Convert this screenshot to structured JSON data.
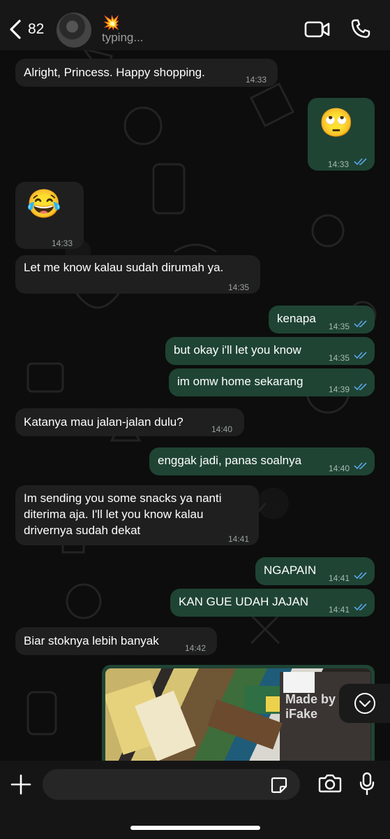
{
  "header": {
    "unread_count": "82",
    "status": "typing...",
    "contact_emoji": "💥"
  },
  "messages": [
    {
      "dir": "in",
      "text": "Alright, Princess. Happy shopping.",
      "time": "14:33"
    },
    {
      "dir": "out",
      "emoji": "🙄",
      "time": "14:33",
      "read": true
    },
    {
      "dir": "in",
      "emoji": "😂",
      "time": "14:33"
    },
    {
      "dir": "in",
      "text": "Let me know kalau sudah dirumah ya.",
      "time": "14:35"
    },
    {
      "dir": "out",
      "text": "kenapa",
      "time": "14:35",
      "read": true
    },
    {
      "dir": "out",
      "text": "but okay i'll let you know",
      "time": "14:35",
      "read": true
    },
    {
      "dir": "out",
      "text": "im omw home sekarang",
      "time": "14:39",
      "read": true
    },
    {
      "dir": "in",
      "text": "Katanya mau jalan-jalan dulu?",
      "time": "14:40"
    },
    {
      "dir": "out",
      "text": "enggak jadi, panas soalnya",
      "time": "14:40",
      "read": true
    },
    {
      "dir": "in",
      "lines": [
        "Im sending you some snacks ya nanti",
        "diterima aja. I'll let you know kalau",
        "drivernya sudah dekat"
      ],
      "time": "14:41"
    },
    {
      "dir": "out",
      "text": "NGAPAIN",
      "time": "14:41",
      "read": true
    },
    {
      "dir": "out",
      "text": "KAN GUE UDAH JAJAN",
      "time": "14:41",
      "read": true
    },
    {
      "dir": "in",
      "text": "Biar stoknya lebih banyak",
      "time": "14:42"
    }
  ],
  "image_message": {
    "watermark": "Made by iFake"
  },
  "input": {
    "placeholder": ""
  },
  "colors": {
    "outgoing": "#1f4434",
    "incoming": "#1f1f1f",
    "ticks": "#5aa7e8"
  }
}
